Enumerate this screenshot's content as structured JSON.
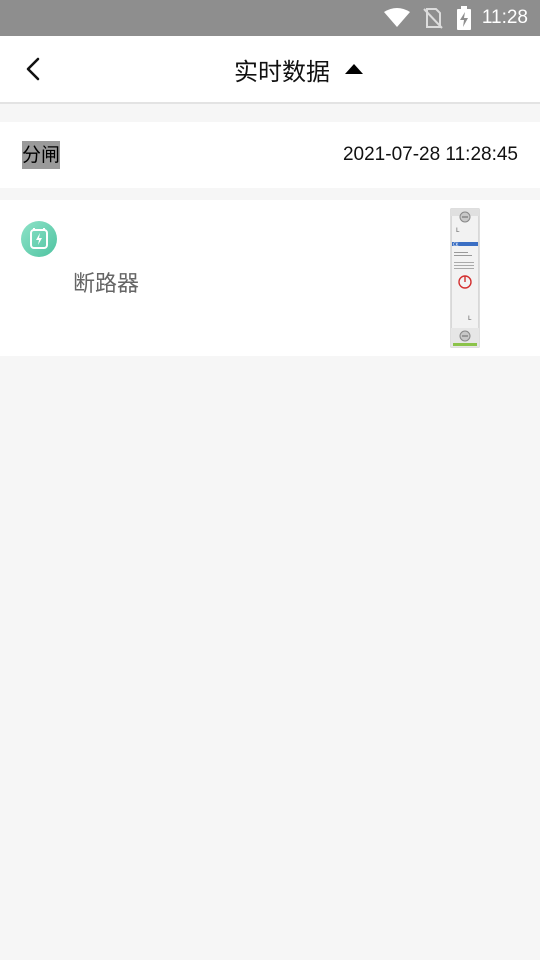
{
  "status_bar": {
    "time": "11:28"
  },
  "header": {
    "title": "实时数据"
  },
  "status_row": {
    "state": "分闸",
    "timestamp": "2021-07-28  11:28:45"
  },
  "device": {
    "name": "断路器",
    "image_labels": {
      "top": "L",
      "bottom": "L",
      "brand": "CK"
    }
  },
  "colors": {
    "accent": "#4fc3a1",
    "power": "#d32f2f",
    "status_bar": "#8e8e8e"
  }
}
